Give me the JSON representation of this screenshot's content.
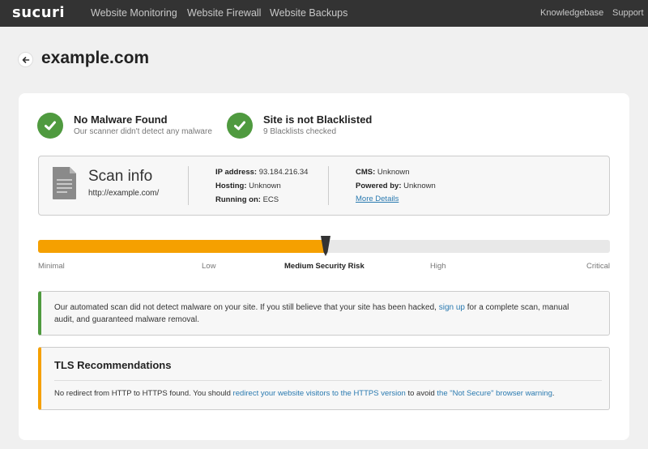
{
  "nav": {
    "logo": "sucuri",
    "links": [
      "Website Monitoring",
      "Website Firewall",
      "Website Backups"
    ],
    "right_links": [
      "Knowledgebase",
      "Support"
    ]
  },
  "page": {
    "title": "example.com",
    "back_icon": "arrow-left-icon"
  },
  "status": [
    {
      "title": "No Malware Found",
      "subtitle": "Our scanner didn't detect any malware",
      "icon": "check-icon"
    },
    {
      "title": "Site is not Blacklisted",
      "subtitle": "9 Blacklists checked",
      "icon": "check-icon"
    }
  ],
  "scan_info": {
    "title": "Scan info",
    "url": "http://example.com/",
    "ip_label": "IP address:",
    "ip_value": "93.184.216.34",
    "hosting_label": "Hosting:",
    "hosting_value": "Unknown",
    "running_label": "Running on:",
    "running_value": "ECS",
    "cms_label": "CMS:",
    "cms_value": "Unknown",
    "powered_label": "Powered by:",
    "powered_value": "Unknown",
    "more_details": "More Details"
  },
  "risk": {
    "labels": [
      "Minimal",
      "Low",
      "Medium Security Risk",
      "High",
      "Critical"
    ],
    "active_index": 2,
    "level_fraction": 0.5
  },
  "notice": {
    "text_before": "Our automated scan did not detect malware on your site. If you still believe that your site has been hacked, ",
    "link": "sign up",
    "text_after": " for a complete scan, manual audit, and guaranteed malware removal."
  },
  "tls": {
    "title": "TLS Recommendations",
    "text_before": "No redirect from HTTP to HTTPS found. You should ",
    "link1": "redirect your website visitors to the HTTPS version",
    "text_middle": " to avoid ",
    "link2": "the \"Not Secure\" browser warning",
    "text_after": "."
  },
  "colors": {
    "success": "#4f9a3f",
    "warning": "#f5a000",
    "link": "#2a7ab0",
    "nav_bg": "#333333"
  }
}
